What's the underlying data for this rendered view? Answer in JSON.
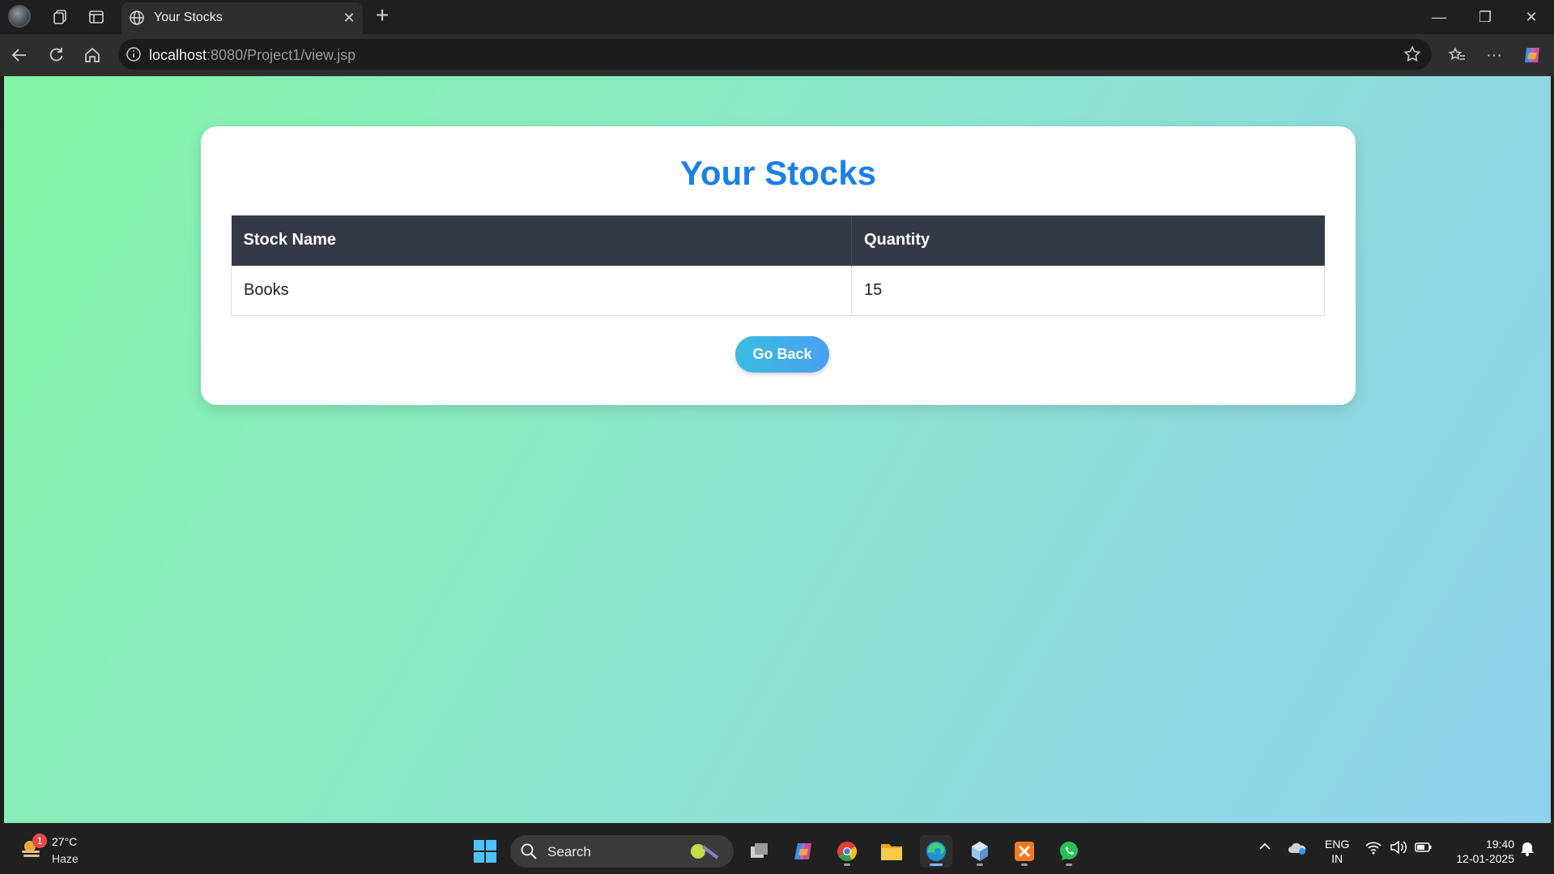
{
  "browser": {
    "tab_title": "Your Stocks",
    "url_host": "localhost",
    "url_path": ":8080/Project1/view.jsp"
  },
  "page": {
    "heading": "Your Stocks",
    "table": {
      "columns": [
        "Stock Name",
        "Quantity"
      ],
      "rows": [
        [
          "Books",
          "15"
        ]
      ]
    },
    "go_back_label": "Go Back"
  },
  "taskbar": {
    "weather_badge": "1",
    "temperature": "27°C",
    "condition": "Haze",
    "search_label": "Search",
    "language_line1": "ENG",
    "language_line2": "IN",
    "time": "19:40",
    "date": "12-01-2025"
  },
  "colors": {
    "heading": "#1c7fe6",
    "table_header_bg": "#343a45",
    "button_gradient_start": "#3bbce0",
    "button_gradient_end": "#4aa0f0",
    "page_gradient_start": "#83f5a8",
    "page_gradient_end": "#8fd2ee"
  }
}
